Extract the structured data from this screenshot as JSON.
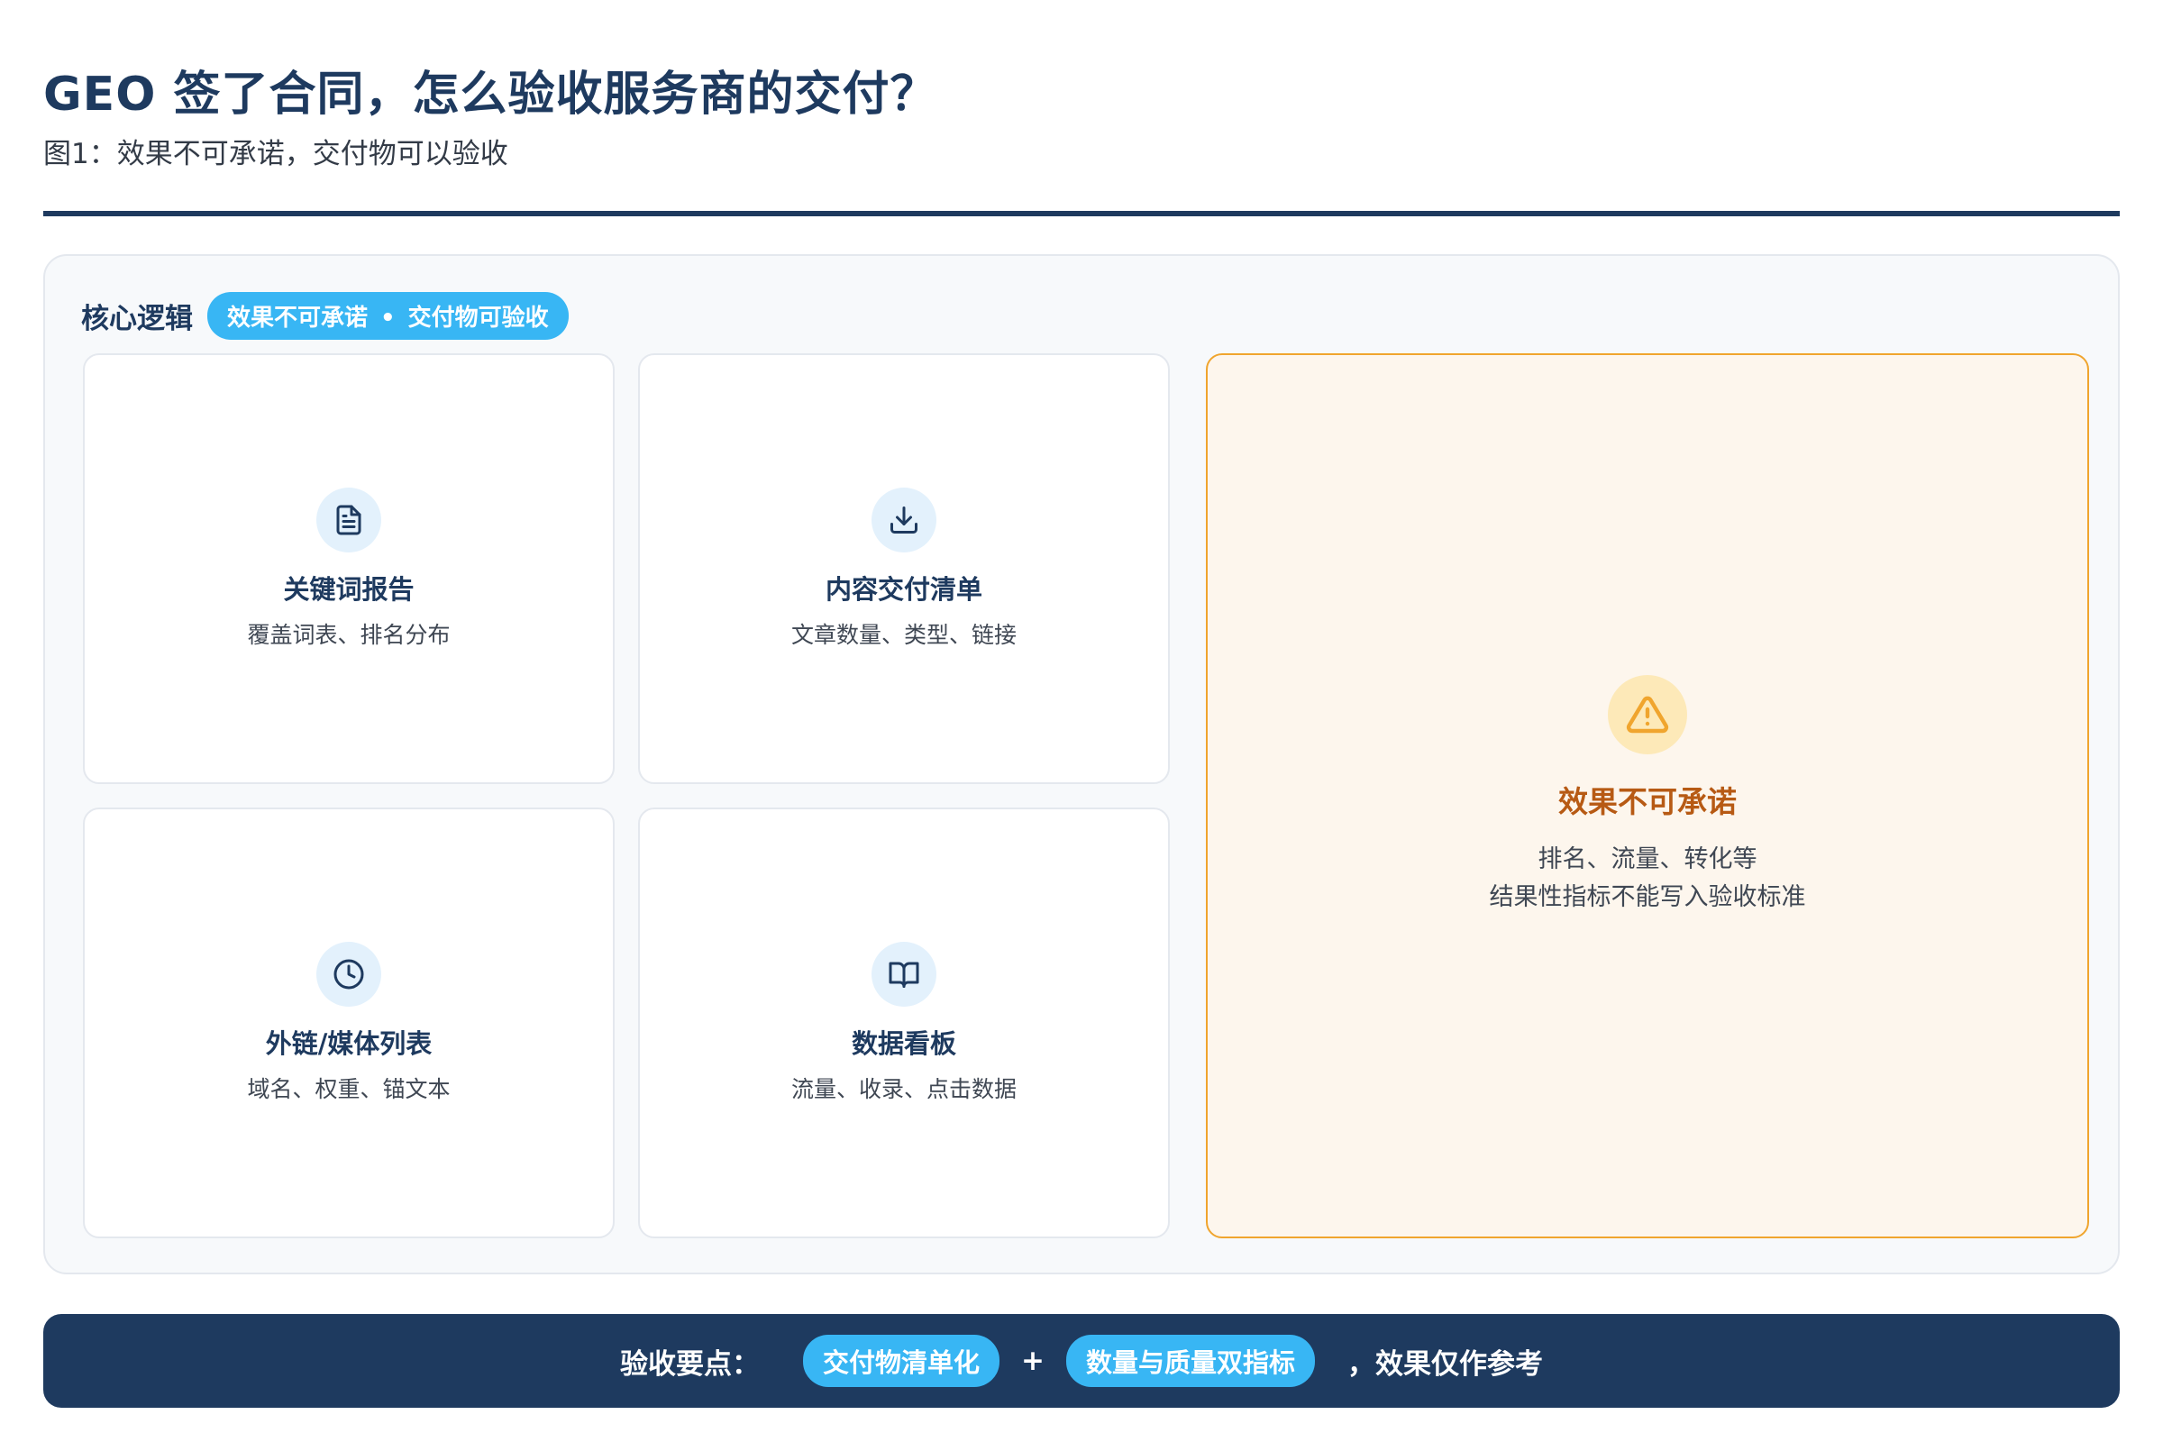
{
  "header": {
    "title": "GEO 签了合同，怎么验收服务商的交付？",
    "subtitle": "图1：效果不可承诺，交付物可以验收"
  },
  "panel": {
    "label": "核心逻辑",
    "pill_left": "效果不可承诺",
    "pill_sep": "•",
    "pill_right": "交付物可验收"
  },
  "cards": [
    {
      "icon": "document-icon",
      "title": "关键词报告",
      "desc": "覆盖词表、排名分布"
    },
    {
      "icon": "download-icon",
      "title": "内容交付清单",
      "desc": "文章数量、类型、链接"
    },
    {
      "icon": "clock-icon",
      "title": "外链/媒体列表",
      "desc": "域名、权重、锚文本"
    },
    {
      "icon": "book-icon",
      "title": "数据看板",
      "desc": "流量、收录、点击数据"
    }
  ],
  "warning": {
    "icon": "warning-triangle-icon",
    "title": "效果不可承诺",
    "line1": "排名、流量、转化等",
    "line2": "结果性指标不能写入验收标准"
  },
  "banner": {
    "lead": "验收要点：",
    "pill1": "交付物清单化",
    "plus": "+",
    "pill2": "数量与质量双指标",
    "tail": "，效果仅作参考"
  },
  "colors": {
    "navy": "#1e3a5f",
    "accent_blue": "#38b6f4",
    "warning_orange": "#f0a52e",
    "warning_text": "#b75a14"
  }
}
